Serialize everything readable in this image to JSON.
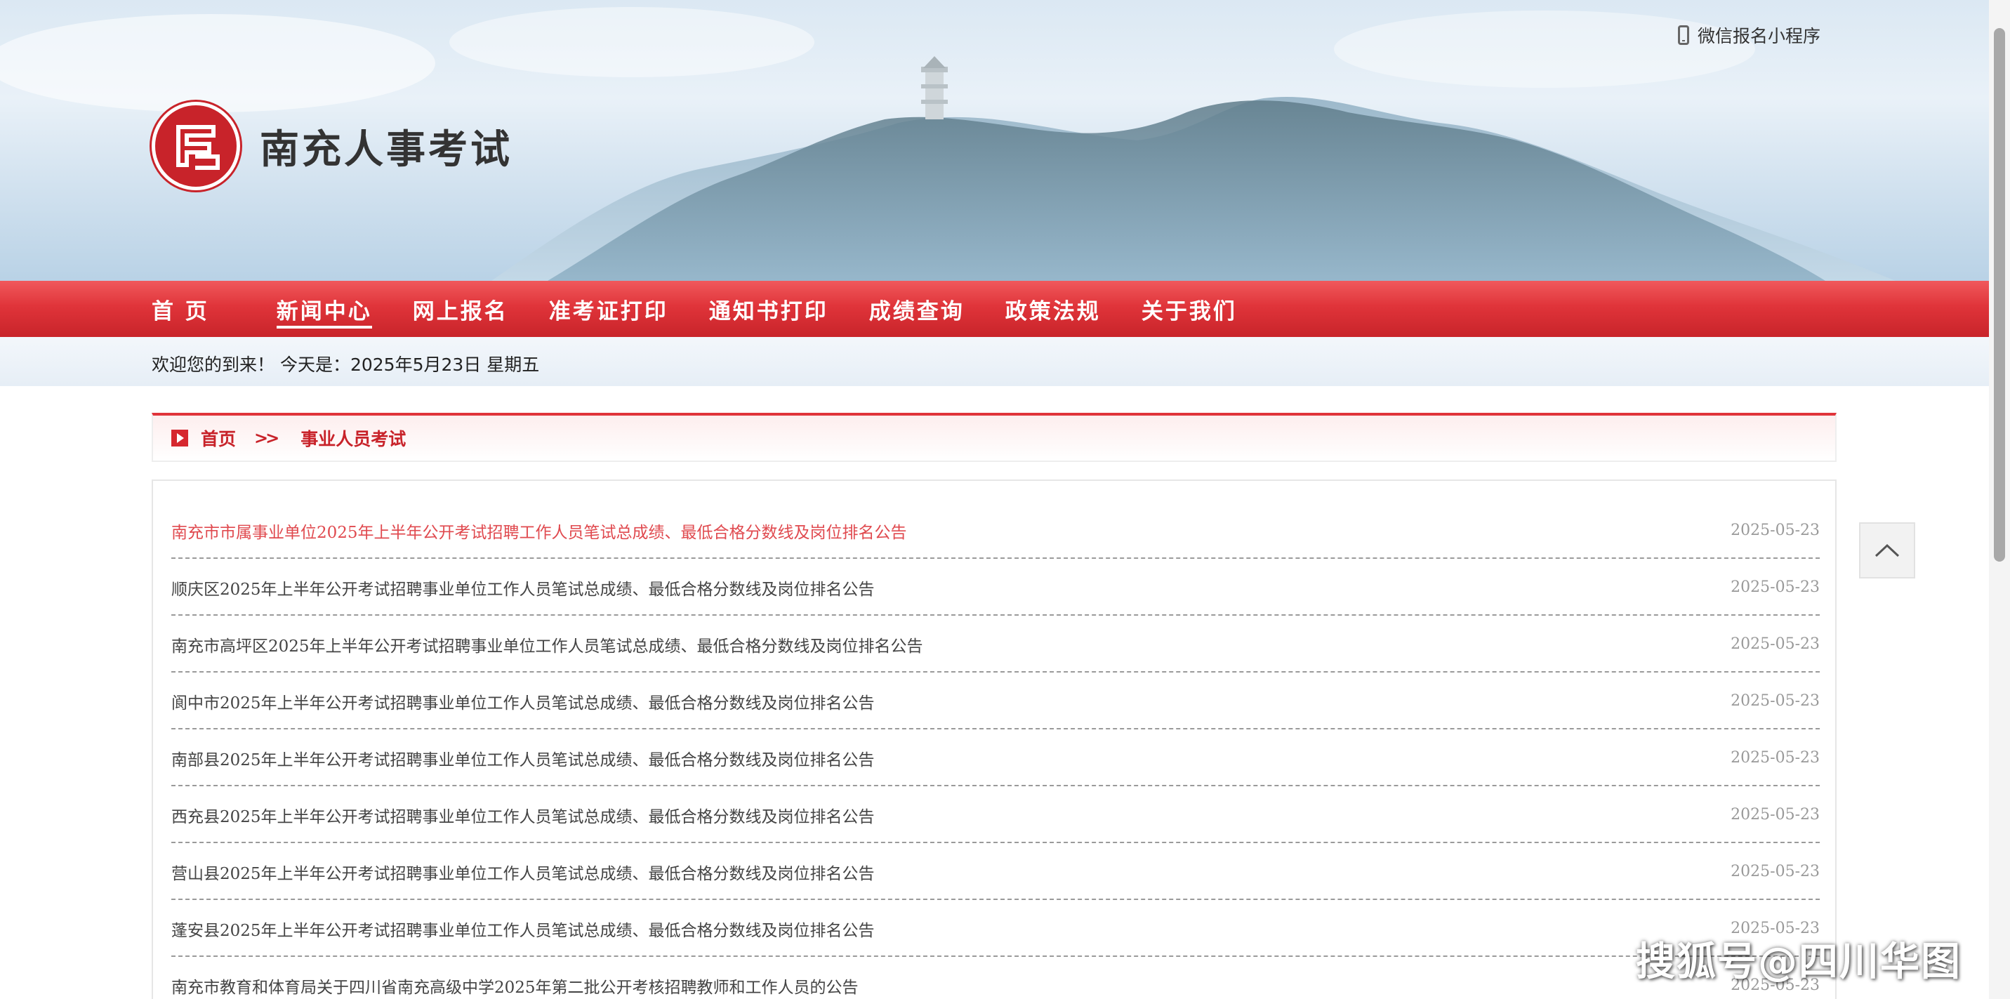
{
  "header": {
    "mini_program_label": "微信报名小程序",
    "site_title": "南充人事考试"
  },
  "nav": {
    "items": [
      {
        "label": "首 页",
        "active": false
      },
      {
        "label": "新闻中心",
        "active": true
      },
      {
        "label": "网上报名",
        "active": false
      },
      {
        "label": "准考证打印",
        "active": false
      },
      {
        "label": "通知书打印",
        "active": false
      },
      {
        "label": "成绩查询",
        "active": false
      },
      {
        "label": "政策法规",
        "active": false
      },
      {
        "label": "关于我们",
        "active": false
      }
    ]
  },
  "welcome": {
    "text": "欢迎您的到来！  今天是：2025年5月23日 星期五"
  },
  "breadcrumb": {
    "home": "首页",
    "separator": ">>",
    "current": "事业人员考试"
  },
  "articles": [
    {
      "title": "南充市市属事业单位2025年上半年公开考试招聘工作人员笔试总成绩、最低合格分数线及岗位排名公告",
      "date": "2025-05-23",
      "highlight": true
    },
    {
      "title": "顺庆区2025年上半年公开考试招聘事业单位工作人员笔试总成绩、最低合格分数线及岗位排名公告",
      "date": "2025-05-23",
      "highlight": false
    },
    {
      "title": "南充市高坪区2025年上半年公开考试招聘事业单位工作人员笔试总成绩、最低合格分数线及岗位排名公告",
      "date": "2025-05-23",
      "highlight": false
    },
    {
      "title": "阆中市2025年上半年公开考试招聘事业单位工作人员笔试总成绩、最低合格分数线及岗位排名公告",
      "date": "2025-05-23",
      "highlight": false
    },
    {
      "title": "南部县2025年上半年公开考试招聘事业单位工作人员笔试总成绩、最低合格分数线及岗位排名公告",
      "date": "2025-05-23",
      "highlight": false
    },
    {
      "title": "西充县2025年上半年公开考试招聘事业单位工作人员笔试总成绩、最低合格分数线及岗位排名公告",
      "date": "2025-05-23",
      "highlight": false
    },
    {
      "title": "营山县2025年上半年公开考试招聘事业单位工作人员笔试总成绩、最低合格分数线及岗位排名公告",
      "date": "2025-05-23",
      "highlight": false
    },
    {
      "title": "蓬安县2025年上半年公开考试招聘事业单位工作人员笔试总成绩、最低合格分数线及岗位排名公告",
      "date": "2025-05-23",
      "highlight": false
    },
    {
      "title": "南充市教育和体育局关于四川省南充高级中学2025年第二批公开考核招聘教师和工作人员的公告",
      "date": "2025-05-23",
      "highlight": false
    }
  ],
  "watermark": "搜狐号@四川华图",
  "colors": {
    "accent_red": "#e0343a",
    "highlight_text": "#e04a4f"
  }
}
